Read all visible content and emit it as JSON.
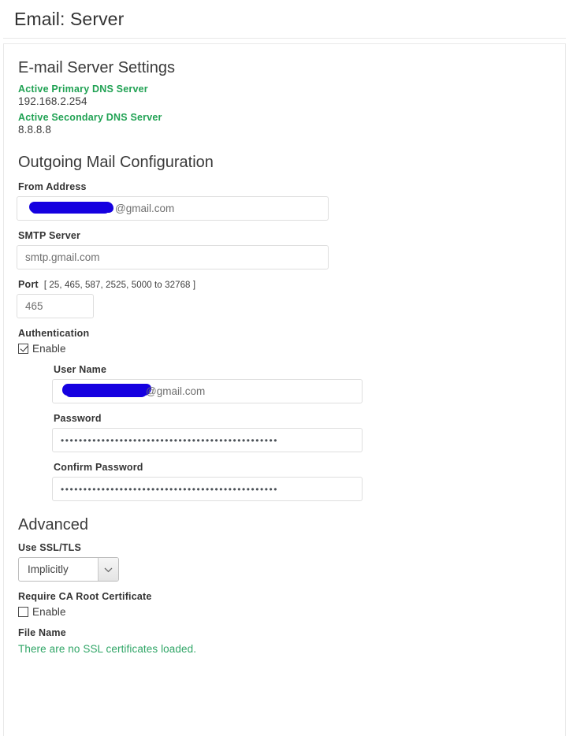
{
  "header": {
    "title": "Email: Server"
  },
  "settings": {
    "section_title": "E-mail Server Settings",
    "primary_dns_label": "Active Primary DNS Server",
    "primary_dns_value": "192.168.2.254",
    "secondary_dns_label": "Active Secondary DNS Server",
    "secondary_dns_value": "8.8.8.8"
  },
  "outgoing": {
    "section_title": "Outgoing Mail Configuration",
    "from_address": {
      "label": "From Address",
      "value": "@gmail.com",
      "redacted": true
    },
    "smtp_server": {
      "label": "SMTP Server",
      "value": "smtp.gmail.com"
    },
    "port": {
      "label": "Port",
      "hint": "[ 25, 465, 587, 2525, 5000 to 32768 ]",
      "value": "465"
    },
    "authentication": {
      "label": "Authentication",
      "enable_label": "Enable",
      "enabled": true,
      "user_name": {
        "label": "User Name",
        "value": "@gmail.com",
        "redacted": true
      },
      "password": {
        "label": "Password",
        "value": "••••••••••••••••••••••••••••••••••••••••••••••••"
      },
      "confirm_password": {
        "label": "Confirm Password",
        "value": "••••••••••••••••••••••••••••••••••••••••••••••••"
      }
    }
  },
  "advanced": {
    "section_title": "Advanced",
    "ssl_tls": {
      "label": "Use SSL/TLS",
      "selected": "Implicitly",
      "options": [
        "Implicitly"
      ]
    },
    "ca_root": {
      "label": "Require CA Root Certificate",
      "enable_label": "Enable",
      "enabled": false
    },
    "file_name": {
      "label": "File Name",
      "status": "There are no SSL certificates loaded."
    }
  },
  "colors": {
    "accent_green": "#21a254",
    "status_green": "#2fa566",
    "redaction_blue": "#1500e0"
  }
}
